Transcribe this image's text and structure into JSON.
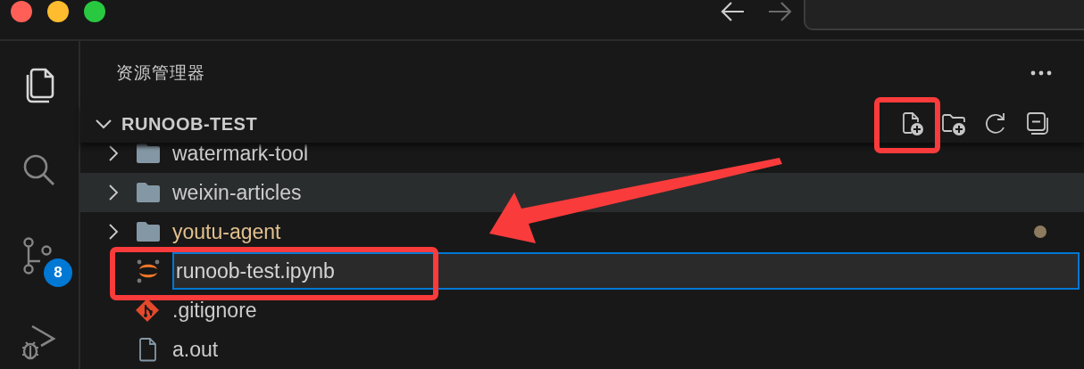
{
  "activity_bar": {
    "items": [
      {
        "kind": "explorer",
        "selected": true
      },
      {
        "kind": "search",
        "selected": false
      },
      {
        "kind": "source_control",
        "selected": false,
        "badge": "8"
      },
      {
        "kind": "run_debug",
        "selected": false
      }
    ]
  },
  "explorer": {
    "title": "资源管理器"
  },
  "section": {
    "title": "RUNOOB-TEST",
    "expanded": true,
    "actions": [
      {
        "kind": "new_file",
        "highlighted": true
      },
      {
        "kind": "new_folder",
        "highlighted": false
      },
      {
        "kind": "refresh",
        "highlighted": false
      },
      {
        "kind": "collapse",
        "highlighted": false
      }
    ]
  },
  "tree": [
    {
      "kind": "folder",
      "name": "watermark-tool",
      "expanded": false,
      "hovered": false,
      "modified": false
    },
    {
      "kind": "folder",
      "name": "weixin-articles",
      "expanded": false,
      "hovered": true,
      "modified": false
    },
    {
      "kind": "folder",
      "name": "youtu-agent",
      "expanded": false,
      "hovered": false,
      "modified": true
    },
    {
      "kind": "notebook_input",
      "value": "runoob-test.ipynb",
      "highlighted": true
    },
    {
      "kind": "git_file",
      "name": ".gitignore"
    },
    {
      "kind": "plain_file",
      "name": "a.out"
    }
  ],
  "annotations": [
    {
      "kind": "arrow"
    }
  ]
}
